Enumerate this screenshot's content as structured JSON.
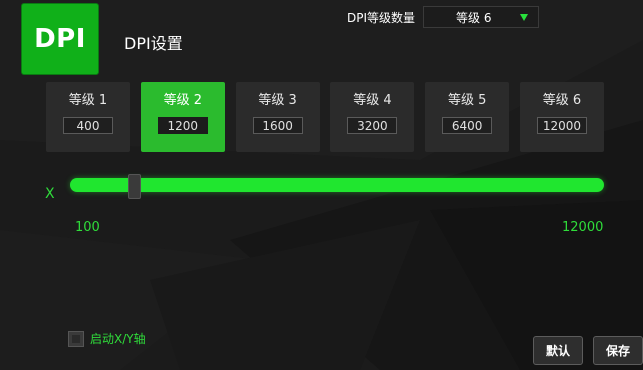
{
  "logo": {
    "text": "DPI"
  },
  "page_title": "DPI设置",
  "level_count": {
    "label": "DPI等级数量",
    "selected": "等级 6",
    "caret_color": "#28e03c"
  },
  "stages": [
    {
      "label": "等级 1",
      "value": "400",
      "active": false
    },
    {
      "label": "等级 2",
      "value": "1200",
      "active": true
    },
    {
      "label": "等级 3",
      "value": "1600",
      "active": false
    },
    {
      "label": "等级 4",
      "value": "3200",
      "active": false
    },
    {
      "label": "等级 5",
      "value": "6400",
      "active": false
    },
    {
      "label": "等级 6",
      "value": "12000",
      "active": false
    }
  ],
  "slider": {
    "axis_label": "X",
    "min_label": "100",
    "max_label": "12000",
    "min": 100,
    "max": 12000,
    "current": 1200
  },
  "xy_toggle": {
    "label": "启动X/Y轴",
    "checked": false
  },
  "buttons": {
    "default_label": "默认",
    "save_label": "保存"
  },
  "colors": {
    "accent": "#20e62f",
    "active_stage": "#2bbb2e",
    "logo": "#10b019",
    "background": "#1b1b1b"
  }
}
